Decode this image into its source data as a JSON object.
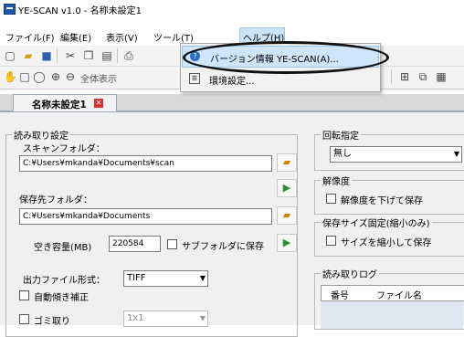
{
  "window": {
    "title": "YE-SCAN v1.0 - 名称未設定1"
  },
  "menu": {
    "file": "ファイル(F)",
    "edit": "編集(E)",
    "view": "表示(V)",
    "tools": "ツール(T)",
    "help": "ヘルプ(H)"
  },
  "help_menu": {
    "about": "バージョン情報 YE-SCAN(A)...",
    "settings": "環境設定..."
  },
  "toolbar": {
    "zoom_all": "全体表示"
  },
  "tab": {
    "label": "名称未設定1"
  },
  "scan_settings": {
    "group_title": "読み取り設定",
    "scan_folder_label": "スキャンフォルダ：",
    "scan_folder_value": "C:¥Users¥mkanda¥Documents¥scan",
    "save_folder_label": "保存先フォルダ：",
    "save_folder_value": "C:¥Users¥mkanda¥Documents",
    "free_space_label": "空き容量(MB)",
    "free_space_value": "220584",
    "save_to_subfolder": "サブフォルダに保存",
    "output_format_label": "出力ファイル形式：",
    "output_format_value": "TIFF",
    "auto_deskew": "自動傾き補正",
    "despeckle": "ゴミ取り",
    "despeckle_value": "1x1"
  },
  "rotation": {
    "group_title": "回転指定",
    "value": "無し"
  },
  "resolution": {
    "group_title": "解像度",
    "reduce": "解像度を下げて保存"
  },
  "fixed_size": {
    "group_title": "保存サイズ固定(縮小のみ)",
    "shrink": "サイズを縮小して保存"
  },
  "scan_log": {
    "group_title": "読み取りログ",
    "col_number": "番号",
    "col_filename": "ファイル名"
  }
}
